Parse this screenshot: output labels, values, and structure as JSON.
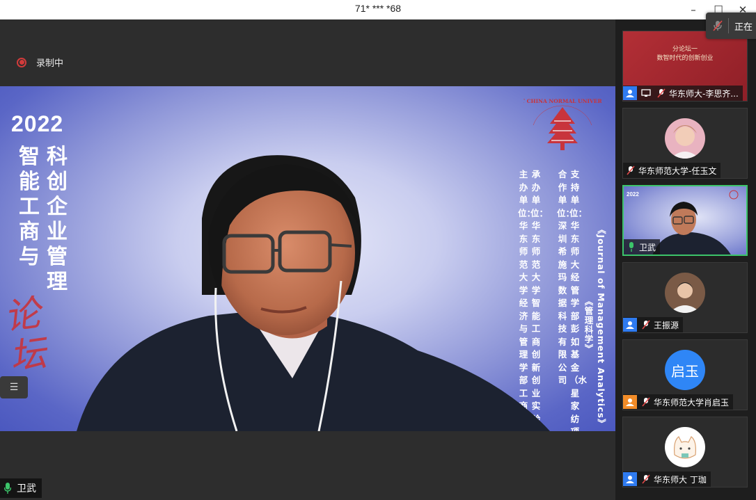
{
  "window": {
    "title": "71* *** *68",
    "minimize_icon": "–",
    "maximize_icon": "☐",
    "close_icon": "✕"
  },
  "status_popup": {
    "label": "正在"
  },
  "recording": {
    "label": "录制中"
  },
  "background": {
    "year": "2022",
    "title_col1": "智能工商与",
    "title_col2": "科创企业管理",
    "forum": "论坛",
    "columns": [
      "支持单位：华东师大经管学部彭如基金（水星家纺项目）",
      "合作单位：深圳希施玛数据科技有限公司",
      "承办单位：华东师范大学智能工商创新创业实验室",
      "主办单位：华东师范大学经济与管理学部工商管理学院"
    ],
    "journal": "《Journal of Management Analytics》《管理科学》",
    "logo_text": "EAST CHINA NORMAL UNIVERSITY"
  },
  "main_speaker": {
    "name": "卫武"
  },
  "menu_icon": "☰",
  "colors": {
    "accent_green": "#3cc46a",
    "badge_blue": "#2f7bf0",
    "badge_orange": "#f28c28",
    "record_red": "#d23b3b"
  },
  "participants": [
    {
      "name": "华东师大-李思齐...",
      "slide_line1": "分论坛一",
      "slide_line2": "数智时代的创新创业"
    },
    {
      "name": "华东师范大学-任玉文"
    },
    {
      "name": "卫武"
    },
    {
      "name": "王振源"
    },
    {
      "name": "华东师范大学肖启玉",
      "avatar_text": "启玉"
    },
    {
      "name": "华东师大 丁珈"
    }
  ]
}
